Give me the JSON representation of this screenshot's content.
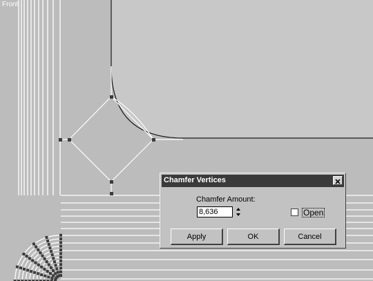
{
  "viewport": {
    "label": "Front"
  },
  "dialog": {
    "title": "Chamfer Vertices",
    "chamfer_amount_label": "Chamfer Amount:",
    "chamfer_amount_value": "8,636",
    "open_label": "Open",
    "open_checked": false,
    "apply_label": "Apply",
    "ok_label": "OK",
    "cancel_label": "Cancel"
  },
  "icons": {
    "close": "close-icon",
    "spin_up": "spinner-up-icon",
    "spin_down": "spinner-down-icon"
  },
  "colors": {
    "viewport_bg": "#bcbcbc",
    "shape_bg": "#c8c8c8",
    "spline_white": "#ffffff",
    "spline_dark": "#1a1a1a",
    "vertex": "#3c3c3c",
    "titlebar": "#3a3a3a"
  }
}
